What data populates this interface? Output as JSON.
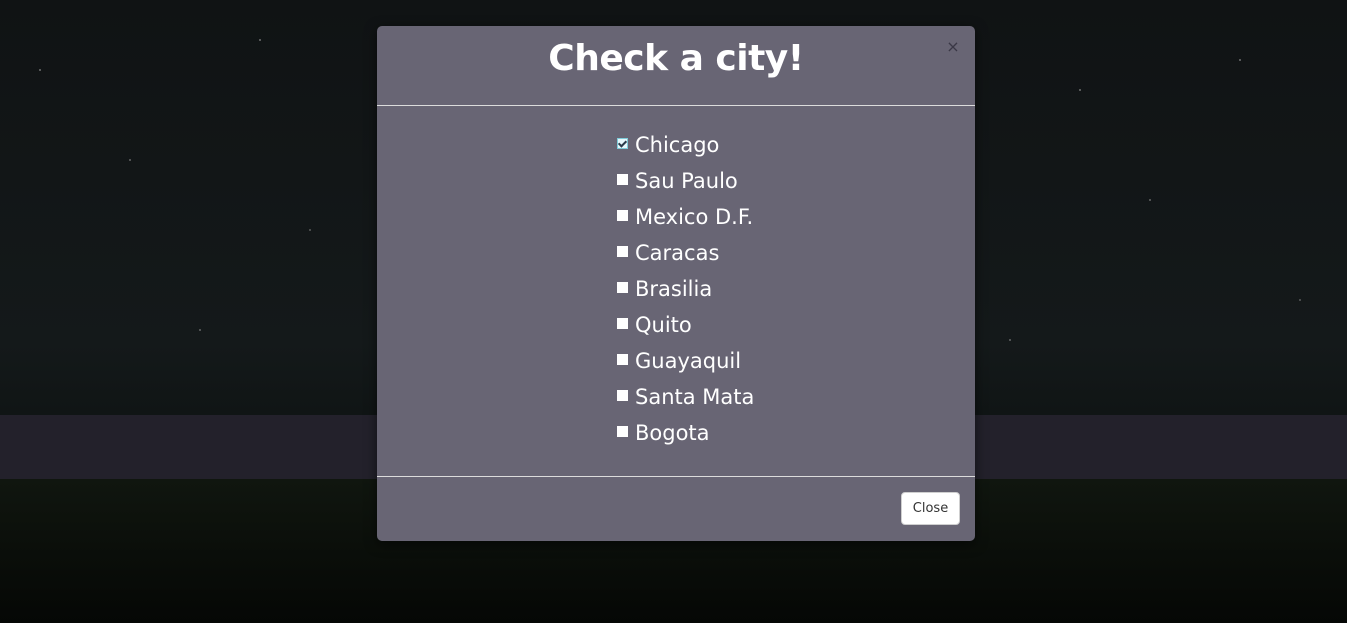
{
  "modal": {
    "title": "Check a city!",
    "close_icon": "×",
    "close_label": "Close"
  },
  "cities": [
    {
      "label": "Chicago",
      "checked": true
    },
    {
      "label": "Sau Paulo",
      "checked": false
    },
    {
      "label": "Mexico D.F.",
      "checked": false
    },
    {
      "label": "Caracas",
      "checked": false
    },
    {
      "label": "Brasilia",
      "checked": false
    },
    {
      "label": "Quito",
      "checked": false
    },
    {
      "label": "Guayaquil",
      "checked": false
    },
    {
      "label": "Santa Mata",
      "checked": false
    },
    {
      "label": "Bogota",
      "checked": false
    }
  ],
  "colors": {
    "modal_background": "#686574",
    "band": "#23212b",
    "text": "#ffffff"
  }
}
